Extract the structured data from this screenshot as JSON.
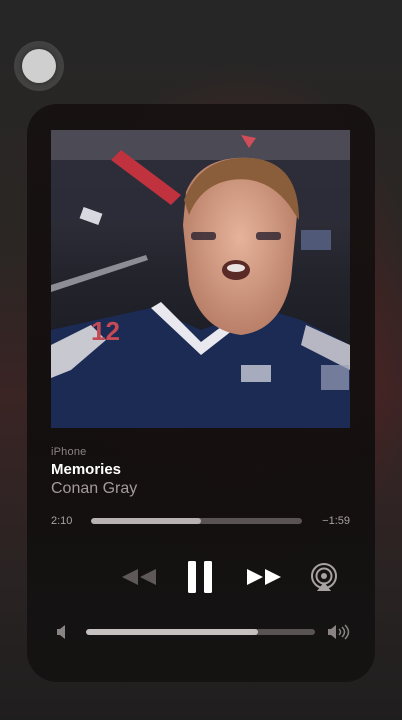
{
  "now_playing": {
    "source": "iPhone",
    "title": "Memories",
    "artist": "Conan Gray",
    "artwork": {
      "icon": "album-artwork-image",
      "jersey_number": "12"
    }
  },
  "progress": {
    "elapsed": "2:10",
    "remaining": "−1:59",
    "fraction": 0.52
  },
  "controls": {
    "rewind_icon": "rewind-icon",
    "pause_icon": "pause-icon",
    "forward_icon": "fast-forward-icon",
    "airplay_icon": "airplay-audio-icon"
  },
  "volume": {
    "level": 0.75,
    "low_icon": "speaker-low-icon",
    "high_icon": "speaker-high-icon"
  },
  "colors": {
    "accent_white": "#ffffff",
    "secondary_text": "#a39a9a",
    "track": "#5a5353",
    "track_fill": "#b9b2b2"
  }
}
